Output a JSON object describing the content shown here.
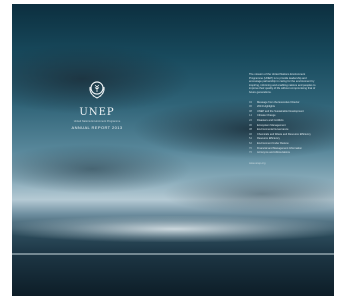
{
  "brand": {
    "acronym": "UNEP",
    "organization": "United Nations Environment Programme",
    "report_title": "ANNUAL REPORT 2013",
    "emblem_icon": "un-wreath-tree-icon"
  },
  "intro_text": "The mission of the United Nations Environment Programme (UNEP) is to provide leadership and encourage partnership in caring for the environment by inspiring, informing and enabling nations and peoples to improve their quality of life without compromising that of future generations.",
  "contents": [
    {
      "num": "04",
      "title": "Message from the Executive Director"
    },
    {
      "num": "06",
      "title": "2013 Highlights"
    },
    {
      "num": "08",
      "title": "UNEP and the Sustainable Development"
    },
    {
      "num": "14",
      "title": "Climate Change"
    },
    {
      "num": "22",
      "title": "Disasters and Conflicts"
    },
    {
      "num": "30",
      "title": "Ecosystem Management"
    },
    {
      "num": "38",
      "title": "Environmental Governance"
    },
    {
      "num": "46",
      "title": "Chemicals and Waste and Resource Efficiency"
    },
    {
      "num": "54",
      "title": "Resource Efficiency"
    },
    {
      "num": "62",
      "title": "Environment Under Review"
    },
    {
      "num": "70",
      "title": "Financial and Management Information"
    },
    {
      "num": "76",
      "title": "Acronyms and Abbreviations"
    }
  ],
  "footer_link": "www.unep.org",
  "colors": {
    "sky_dark": "#0c2f3f",
    "sky_light": "#b5cad4",
    "text": "#eef3f5"
  }
}
